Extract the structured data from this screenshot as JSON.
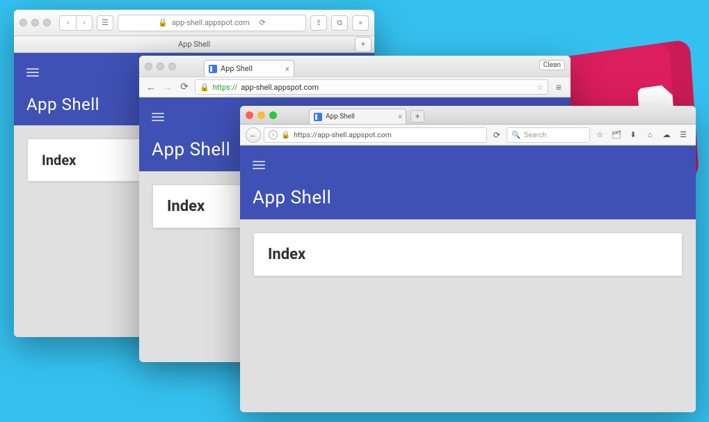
{
  "app": {
    "title": "App Shell",
    "card_heading": "Index"
  },
  "safari": {
    "url_display": "app-shell.appspot.com",
    "tab_label": "App Shell"
  },
  "chrome": {
    "tab_label": "App Shell",
    "url_https": "https://",
    "url_rest": "app-shell.appspot.com",
    "clean_label": "Clean"
  },
  "firefox": {
    "tab_label": "App Shell",
    "url": "https://app-shell.appspot.com",
    "search_placeholder": "Search"
  }
}
